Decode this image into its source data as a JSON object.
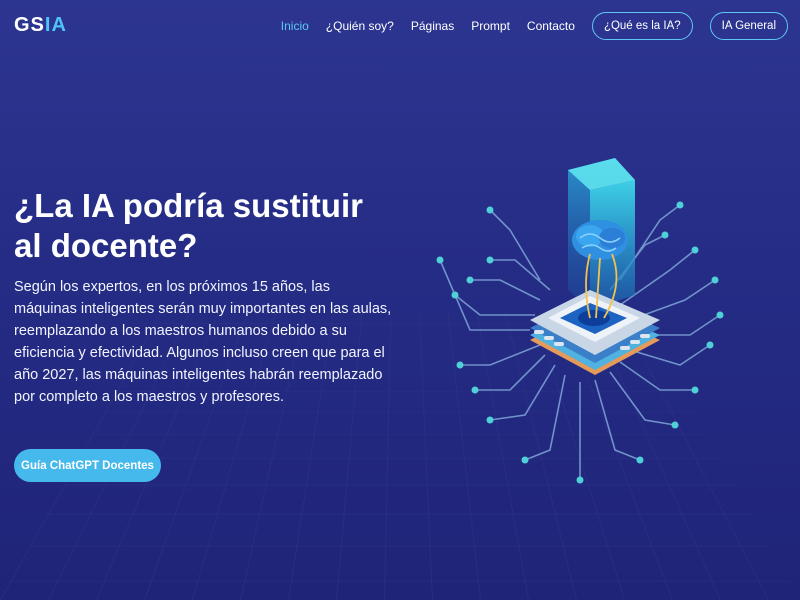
{
  "header": {
    "logo": {
      "part1": "GS",
      "part2": "IA"
    },
    "nav": [
      {
        "label": "Inicio",
        "active": true
      },
      {
        "label": "¿Quién soy?"
      },
      {
        "label": "Páginas"
      },
      {
        "label": "Prompt"
      },
      {
        "label": "Contacto"
      }
    ],
    "buttons": [
      {
        "label": "¿Qué es la IA?"
      },
      {
        "label": "IA General"
      }
    ]
  },
  "hero": {
    "title": "¿La IA podría sustituir al docente?",
    "text": "Según los expertos, en los próximos 15 años, las máquinas inteligentes serán muy importantes en las aulas, reemplazando a los maestros humanos debido a su eficiencia y efectividad. Algunos incluso creen que para el año 2027, las máquinas inteligentes habrán reemplazado por completo a los maestros y profesores.",
    "cta_label": "Guía ChatGPT Docentes"
  },
  "illustration": {
    "icon": "ai-chip-brain-icon"
  },
  "colors": {
    "accent": "#45b8ec",
    "background": "#2a328c"
  }
}
